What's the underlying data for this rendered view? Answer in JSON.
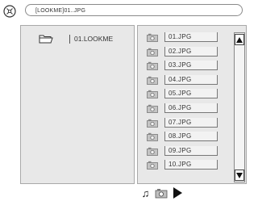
{
  "header": {
    "disc_icon": "disc-icon",
    "path": "[LOOKME]01..JPG"
  },
  "left_panel": {
    "folder_icon": "folder-open-icon",
    "folder_label": "01.LOOKME"
  },
  "right_panel": {
    "file_icon": "camera-photo-icon",
    "files": [
      "01.JPG",
      "02.JPG",
      "03.JPG",
      "04.JPG",
      "05.JPG",
      "06.JPG",
      "07.JPG",
      "08.JPG",
      "09.JPG",
      "10.JPG"
    ]
  },
  "controls": {
    "music_icon": "music-note-icon",
    "photo_icon": "camera-photo-icon",
    "play_icon": "play-icon",
    "music_glyph": "♫"
  }
}
